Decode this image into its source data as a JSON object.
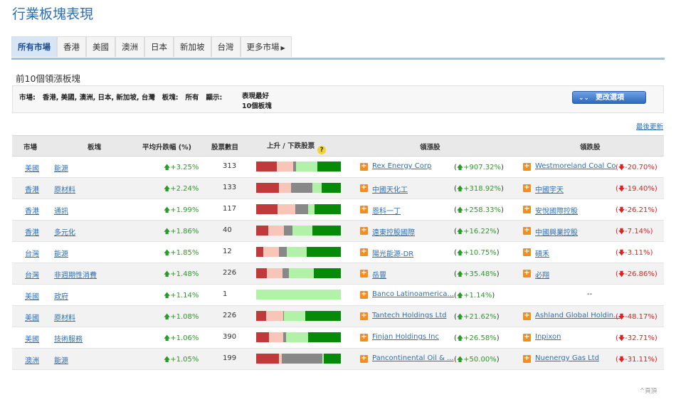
{
  "page_title": "行業板塊表現",
  "tabs": [
    "所有市場",
    "香港",
    "美國",
    "澳洲",
    "日本",
    "新加坡",
    "台灣",
    "更多市場"
  ],
  "subtitle": "前10個領漲板塊",
  "filter": {
    "markets_label": "市場:",
    "markets_value": "香港, 美國, 澳洲, 日本, 新加坡, 台灣",
    "sector_label": "板塊:",
    "sector_value": "所有",
    "show_label": "顯示:",
    "show_value_1": "表現最好",
    "show_value_2": "10個板塊",
    "change_button": "更改選項"
  },
  "update_link": "最後更新",
  "headers": {
    "market": "市場",
    "sector": "板塊",
    "avg_change": "平均升跌幅 (%)",
    "stock_count": "股票數目",
    "up_down": "上升 / 下跌股票",
    "leader_gain": "領漲股",
    "leader_loss": "領跌股"
  },
  "rows": [
    {
      "market": "美國",
      "sector": "能源",
      "avg": "+3.25%",
      "count": "313",
      "gainer": "Rex Energy Corp",
      "gainer_pct": "+907.32%",
      "loser": "Westmoreland Coal Co",
      "loser_pct": "-20.70%",
      "bar": [
        0.24,
        0.2,
        0.03,
        0.25,
        0.28
      ]
    },
    {
      "market": "香港",
      "sector": "原材料",
      "avg": "+2.24%",
      "count": "133",
      "gainer": "中國天化工",
      "gainer_pct": "+318.92%",
      "loser": "中國宇天",
      "loser_pct": "-19.40%",
      "bar": [
        0.27,
        0.14,
        0.25,
        0.11,
        0.23
      ]
    },
    {
      "market": "香港",
      "sector": "通訊",
      "avg": "+1.99%",
      "count": "117",
      "gainer": "恩科一丁",
      "gainer_pct": "+258.33%",
      "loser": "安悅國際控股",
      "loser_pct": "-26.21%",
      "bar": [
        0.25,
        0.21,
        0.15,
        0.08,
        0.31
      ]
    },
    {
      "market": "香港",
      "sector": "多元化",
      "avg": "+1.86%",
      "count": "40",
      "gainer": "遠東控股國際",
      "gainer_pct": "+16.22%",
      "loser": "中國興業控股",
      "loser_pct": "-7.14%",
      "bar": [
        0.14,
        0.19,
        0.1,
        0.23,
        0.34
      ]
    },
    {
      "market": "台灣",
      "sector": "能源",
      "avg": "+1.85%",
      "count": "12",
      "gainer": "陽光能源-DR",
      "gainer_pct": "+10.75%",
      "loser": "碩禾",
      "loser_pct": "-3.11%",
      "bar": [
        0.08,
        0.19,
        0.09,
        0.24,
        0.4
      ]
    },
    {
      "market": "台灣",
      "sector": "非週期性消費",
      "avg": "+1.48%",
      "count": "226",
      "gainer": "岳豐",
      "gainer_pct": "+35.48%",
      "loser": "必翔",
      "loser_pct": "-26.86%",
      "bar": [
        0.13,
        0.18,
        0.08,
        0.29,
        0.32
      ]
    },
    {
      "market": "美國",
      "sector": "政府",
      "avg": "+1.14%",
      "count": "1",
      "gainer": "Banco Latinoamerica...",
      "gainer_pct": "+1.14%",
      "loser": "",
      "loser_pct": "--",
      "bar": [
        0,
        0,
        0,
        1.0,
        0
      ]
    },
    {
      "market": "美國",
      "sector": "原材料",
      "avg": "+1.08%",
      "count": "226",
      "gainer": "Tantech Holdings Ltd",
      "gainer_pct": "+21.62%",
      "loser": "Ashland Global Holdin...",
      "loser_pct": "-48.17%",
      "bar": [
        0.12,
        0.2,
        0.01,
        0.25,
        0.42
      ]
    },
    {
      "market": "美國",
      "sector": "技術服務",
      "avg": "+1.06%",
      "count": "390",
      "gainer": "Finjan Holdings Inc",
      "gainer_pct": "+26.58%",
      "loser": "Inpixon",
      "loser_pct": "-32.71%",
      "bar": [
        0.15,
        0.17,
        0.03,
        0.26,
        0.39
      ]
    },
    {
      "market": "澳洲",
      "sector": "能源",
      "avg": "+1.05%",
      "count": "199",
      "gainer": "Pancontinental Oil & ...",
      "gainer_pct": "+50.00%",
      "loser": "Nuenergy Gas Ltd",
      "loser_pct": "-31.11%",
      "bar": [
        0.27,
        0.03,
        0.48,
        0.02,
        0.2
      ]
    }
  ],
  "bar_colors": [
    "#c0393b",
    "#f7c6b8",
    "#888888",
    "#b2f2a8",
    "#078a07"
  ],
  "footer_top": "^頁頂"
}
